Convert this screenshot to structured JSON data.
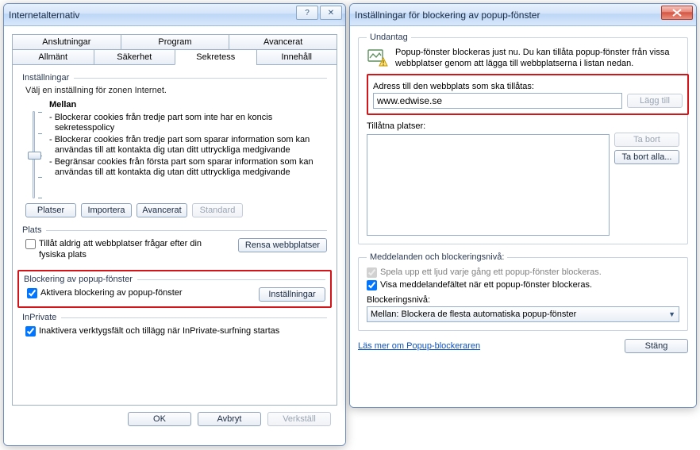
{
  "inet": {
    "title": "Internetalternativ",
    "tabs_top": [
      "Anslutningar",
      "Program",
      "Avancerat"
    ],
    "tabs_bot": [
      "Allmänt",
      "Säkerhet",
      "Sekretess",
      "Innehåll"
    ],
    "active_tab": "Sekretess",
    "settings": {
      "header": "Inställningar",
      "instr": "Välj en inställning för zonen Internet.",
      "level": "Mellan",
      "bullets": [
        "- Blockerar cookies från tredje part som inte har en koncis sekretesspolicy",
        "- Blockerar cookies från tredje part som sparar information som kan användas till att kontakta dig utan ditt uttryckliga medgivande",
        "- Begränsar cookies från första part som sparar information som kan användas till att kontakta dig utan ditt uttryckliga medgivande"
      ],
      "btn_platser": "Platser",
      "btn_importera": "Importera",
      "btn_avancerat": "Avancerat",
      "btn_standard": "Standard"
    },
    "plats": {
      "header": "Plats",
      "chk_text": "Tillåt aldrig att webbplatser frågar efter din fysiska plats",
      "btn_rensa": "Rensa webbplatser"
    },
    "popup": {
      "header": "Blockering av popup-fönster",
      "chk_text": "Aktivera blockering av popup-fönster",
      "btn_installningar": "Inställningar"
    },
    "inprivate": {
      "header": "InPrivate",
      "chk_text": "Inaktivera verktygsfält och tillägg när InPrivate-surfning startas"
    },
    "btn_ok": "OK",
    "btn_avbryt": "Avbryt",
    "btn_verkstall": "Verkställ"
  },
  "pop": {
    "title": "Inställningar för blockering av popup-fönster",
    "undantag": {
      "legend": "Undantag",
      "desc": "Popup-fönster blockeras just nu. Du kan tillåta popup-fönster från vissa webbplatser genom att lägga till webbplatserna i listan nedan.",
      "addr_label": "Adress till den webbplats som ska tillåtas:",
      "addr_value": "www.edwise.se",
      "btn_add": "Lägg till",
      "allowed_label": "Tillåtna platser:",
      "btn_remove": "Ta bort",
      "btn_remove_all": "Ta bort alla..."
    },
    "notif": {
      "legend": "Meddelanden och blockeringsnivå:",
      "chk_sound": "Spela upp ett ljud varje gång ett popup-fönster blockeras.",
      "chk_bar": "Visa meddelandefältet när ett popup-fönster blockeras.",
      "level_label": "Blockeringsnivå:",
      "combo_value": "Mellan: Blockera de flesta automatiska popup-fönster"
    },
    "link": "Läs mer om Popup-blockeraren",
    "btn_close": "Stäng"
  }
}
